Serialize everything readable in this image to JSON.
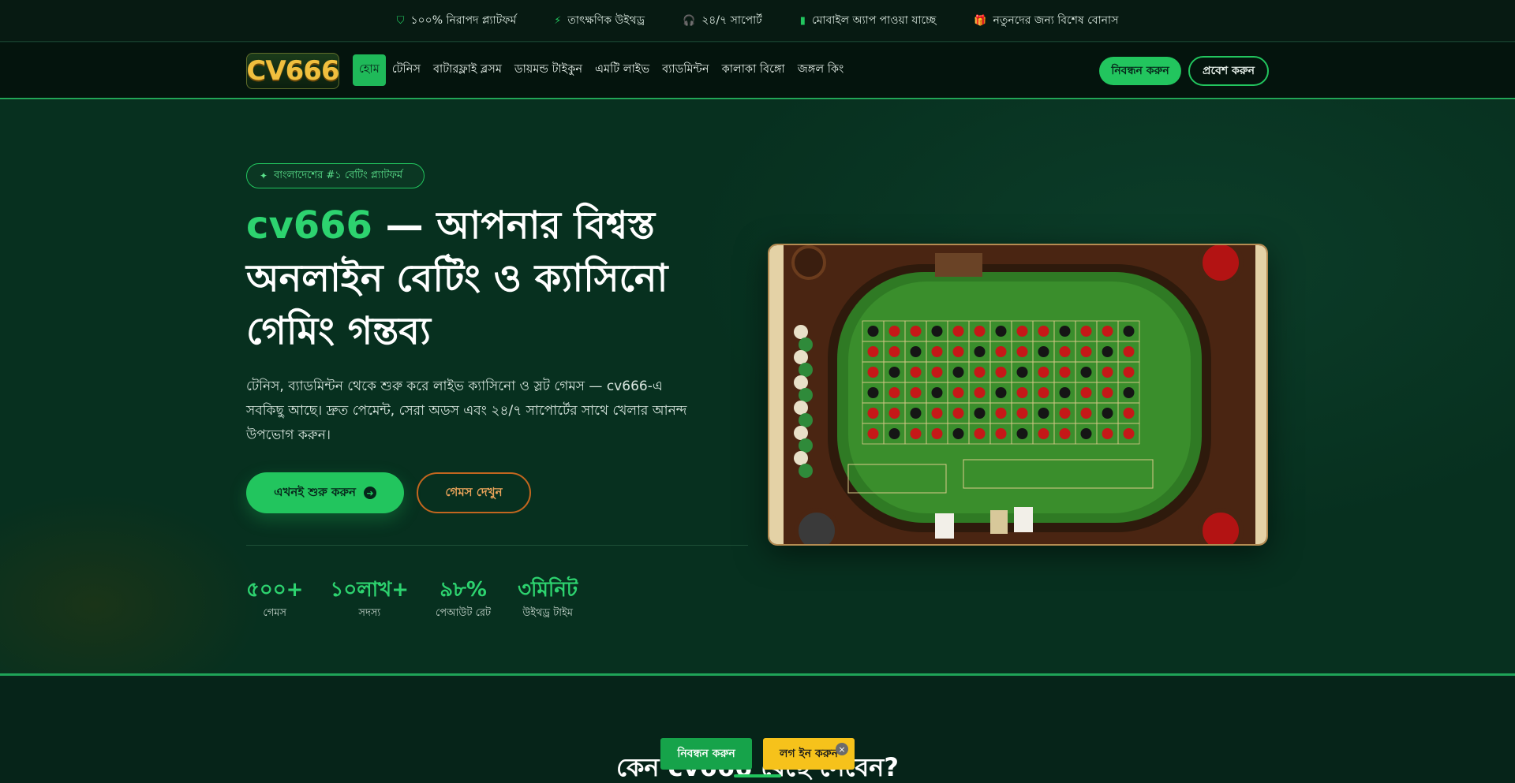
{
  "topbar": {
    "items": [
      {
        "icon": "shield-icon",
        "glyph": "⛉",
        "label": "১০০% নিরাপদ প্ল্যাটফর্ম"
      },
      {
        "icon": "bolt-icon",
        "glyph": "⚡",
        "label": "তাৎক্ষণিক উইথড্র"
      },
      {
        "icon": "headset-icon",
        "glyph": "🎧",
        "label": "২৪/৭ সাপোর্ট"
      },
      {
        "icon": "mobile-icon",
        "glyph": "▮",
        "label": "মোবাইল অ্যাপ পাওয়া যাচ্ছে"
      },
      {
        "icon": "gift-icon",
        "glyph": "🎁",
        "label": "নতুনদের জন্য বিশেষ বোনাস"
      }
    ]
  },
  "nav": {
    "logo": "CV666",
    "menu": [
      "হোম",
      "টেনিস",
      "বাটারফ্লাই ব্লসম",
      "ডায়মন্ড টাইকুন",
      "এমটি লাইভ",
      "ব্যাডমিন্টন",
      "কালাকা বিঙ্গো",
      "জঙ্গল কিং"
    ],
    "active_index": 0,
    "register_label": "নিবন্ধন করুন",
    "login_label": "প্রবেশ করুন"
  },
  "hero": {
    "badge": "বাংলাদেশের #১ বেটিং প্ল্যাটফর্ম",
    "title_accent": "cv666",
    "title_rest": " — আপনার বিশ্বস্ত অনলাইন বেটিং ও ক্যাসিনো গেমিং গন্তব্য",
    "lead": "টেনিস, ব্যাডমিন্টন থেকে শুরু করে লাইভ ক্যাসিনো ও স্লট গেমস — cv666-এ সবকিছু আছে। দ্রুত পেমেন্ট, সেরা অডস এবং ২৪/৭ সাপোর্টের সাথে খেলার আনন্দ উপভোগ করুন।",
    "cta_primary": "এখনই শুরু করুন",
    "cta_secondary": "গেমস দেখুন",
    "stats": [
      {
        "value": "৫০০+",
        "label": "গেমস"
      },
      {
        "value": "১০লাখ+",
        "label": "সদস্য"
      },
      {
        "value": "৯৮%",
        "label": "পেআউট রেট"
      },
      {
        "value": "৩মিনিট",
        "label": "উইথড্র টাইম"
      }
    ]
  },
  "section2": {
    "title": "কেন cv666 বেছে নেবেন?"
  },
  "floating": {
    "register_label": "নিবন্ধন করুন",
    "login_label": "লগ ইন করুন",
    "close_glyph": "×"
  },
  "colors": {
    "accent": "#22c55e",
    "background": "#07301f",
    "secondary_cta": "#c2661f",
    "login_float": "#f6c21b"
  }
}
